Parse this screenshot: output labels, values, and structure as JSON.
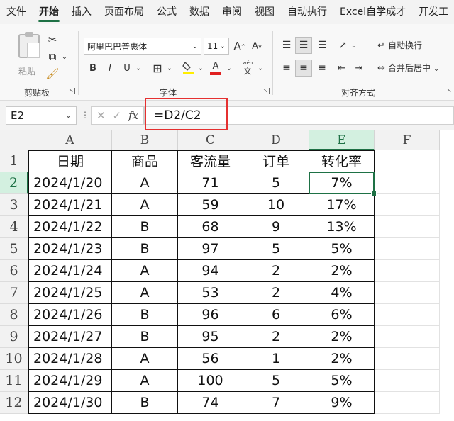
{
  "menu": {
    "tabs": [
      "文件",
      "开始",
      "插入",
      "页面布局",
      "公式",
      "数据",
      "审阅",
      "视图",
      "自动执行",
      "Excel自学成才",
      "开发工"
    ],
    "active_tab": "开始"
  },
  "ribbon": {
    "clipboard": {
      "paste_label": "粘贴",
      "group_label": "剪贴板"
    },
    "font": {
      "font_name": "阿里巴巴普惠体",
      "font_size": "11",
      "bold": "B",
      "italic": "I",
      "underline": "U",
      "grow": "A",
      "shrink": "A",
      "font_color_letter": "A",
      "pinyin_top": "wén",
      "pinyin_bottom": "文",
      "group_label": "字体"
    },
    "alignment": {
      "wrap_text": "自动换行",
      "merge_center": "合并后居中",
      "group_label": "对齐方式"
    }
  },
  "formula_bar": {
    "name_box": "E2",
    "formula": "=D2/C2",
    "fx": "fx",
    "cancel": "✕",
    "enter": "✓"
  },
  "sheet": {
    "columns": [
      "A",
      "B",
      "C",
      "D",
      "E",
      "F"
    ],
    "rows": [
      "1",
      "2",
      "3",
      "4",
      "5",
      "6",
      "7",
      "8",
      "9",
      "10",
      "11",
      "12"
    ],
    "headers": [
      "日期",
      "商品",
      "客流量",
      "订单",
      "转化率"
    ],
    "data": [
      [
        "2024/1/20",
        "A",
        "71",
        "5",
        "7%"
      ],
      [
        "2024/1/21",
        "A",
        "59",
        "10",
        "17%"
      ],
      [
        "2024/1/22",
        "B",
        "68",
        "9",
        "13%"
      ],
      [
        "2024/1/23",
        "B",
        "97",
        "5",
        "5%"
      ],
      [
        "2024/1/24",
        "A",
        "94",
        "2",
        "2%"
      ],
      [
        "2024/1/25",
        "A",
        "53",
        "2",
        "4%"
      ],
      [
        "2024/1/26",
        "B",
        "96",
        "6",
        "6%"
      ],
      [
        "2024/1/27",
        "B",
        "95",
        "2",
        "2%"
      ],
      [
        "2024/1/28",
        "A",
        "56",
        "1",
        "2%"
      ],
      [
        "2024/1/29",
        "A",
        "100",
        "5",
        "5%"
      ],
      [
        "2024/1/30",
        "B",
        "74",
        "7",
        "9%"
      ]
    ],
    "selected_cell": "E2"
  },
  "colors": {
    "accent": "#1e7145",
    "highlight_border": "#e53030"
  }
}
